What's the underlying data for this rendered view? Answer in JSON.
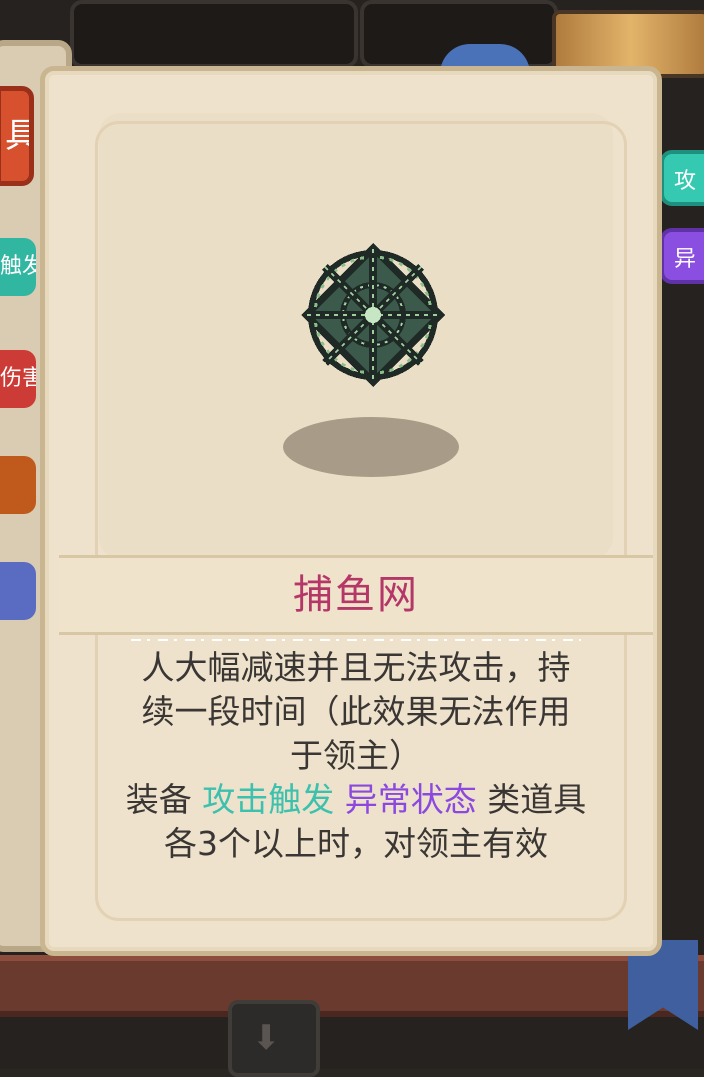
{
  "background": {
    "left_tags": [
      {
        "label": "具",
        "color": "#d7512e"
      },
      {
        "label": "触发",
        "color": "#31b6a2"
      },
      {
        "label": "伤害",
        "color": "#cc3b35"
      },
      {
        "label": "",
        "color": "#c05a1c"
      },
      {
        "label": "",
        "color": "#5a6cc2"
      }
    ],
    "right_tags": [
      {
        "label": "攻",
        "color": "#36c9b1"
      },
      {
        "label": "异",
        "color": "#8a4fe0"
      }
    ]
  },
  "card": {
    "item_name": "捕鱼网",
    "item_icon": "fishing-net-icon",
    "description_line1": "人大幅减速并且无法攻击，持",
    "description_line2": "续一段时间（此效果无法作用",
    "description_line3": "于领主）",
    "equip_prefix": "装备",
    "keyword_attack_trigger": "攻击触发",
    "keyword_status": "异常状态",
    "equip_suffix": "类道具",
    "condition_text": "各3个以上时，对领主有效",
    "colors": {
      "title": "#b53768",
      "keyword_teal": "#3bc1ad",
      "keyword_purple": "#8c49df",
      "body_text": "#3a3633"
    }
  }
}
